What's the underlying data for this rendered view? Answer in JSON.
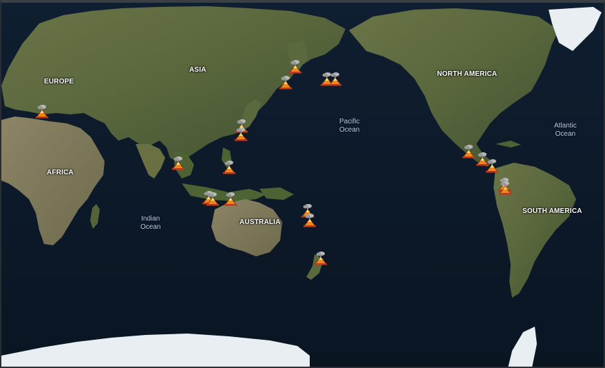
{
  "map": {
    "continents": [
      {
        "id": "europe",
        "label": "EUROPE"
      },
      {
        "id": "asia",
        "label": "ASIA"
      },
      {
        "id": "africa",
        "label": "AFRICA"
      },
      {
        "id": "australia",
        "label": "AUSTRALIA"
      },
      {
        "id": "north-america",
        "label": "NORTH AMERICA"
      },
      {
        "id": "south-america",
        "label": "SOUTH AMERICA"
      }
    ],
    "oceans": {
      "pacific": {
        "line1": "Pacific",
        "line2": "Ocean"
      },
      "atlantic": {
        "line1": "Atlantic",
        "line2": "Ocean"
      },
      "indian": {
        "line1": "Indian",
        "line2": "Ocean"
      }
    },
    "marker_icon": "volcano-icon",
    "marker_count": 21,
    "colors": {
      "ocean": "#0d1a2b",
      "land": "#5b6a3e",
      "ice": "#e9eef2",
      "volcano_orange": "#f0861c",
      "volcano_smoke": "#b8b8b8"
    }
  }
}
